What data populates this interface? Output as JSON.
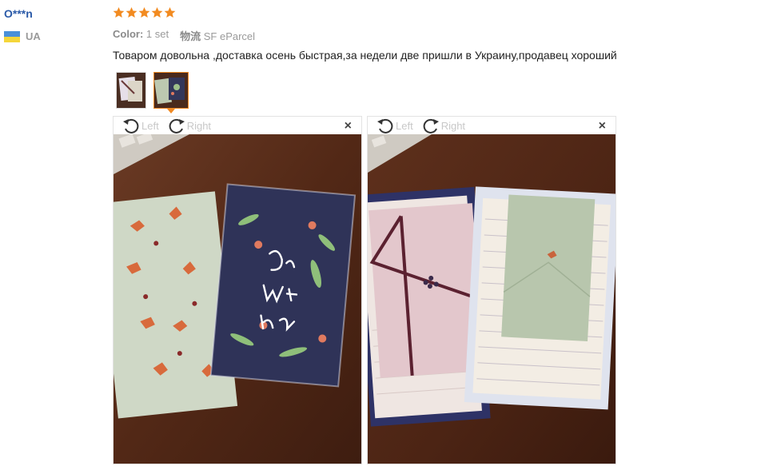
{
  "reviewer": {
    "name": "O***n",
    "country_code": "UA"
  },
  "rating": {
    "stars": 5,
    "color": "#f28b21"
  },
  "meta": {
    "color_label": "Color:",
    "color_value": "1 set",
    "shipping_label": "物流",
    "shipping_value": "SF eParcel"
  },
  "review_text": "Товаром довольна ,доставка осень быстрая,за недели две пришли в Украину,продавец хороший",
  "thumbnails": [
    {
      "name": "photo-1",
      "selected": false
    },
    {
      "name": "photo-2",
      "selected": true
    }
  ],
  "viewers": [
    {
      "rotate_left_label": "Left",
      "rotate_right_label": "Right",
      "close_label": "×"
    },
    {
      "rotate_left_label": "Left",
      "rotate_right_label": "Right",
      "close_label": "×"
    }
  ],
  "icons": {
    "star": "star-icon",
    "flag": "ukraine-flag-icon",
    "rotate_left": "rotate-left-icon",
    "rotate_right": "rotate-right-icon",
    "close": "close-icon"
  },
  "colors": {
    "username": "#2b5aa8",
    "accent": "#f08a24",
    "muted_text": "#9a9a9a"
  }
}
